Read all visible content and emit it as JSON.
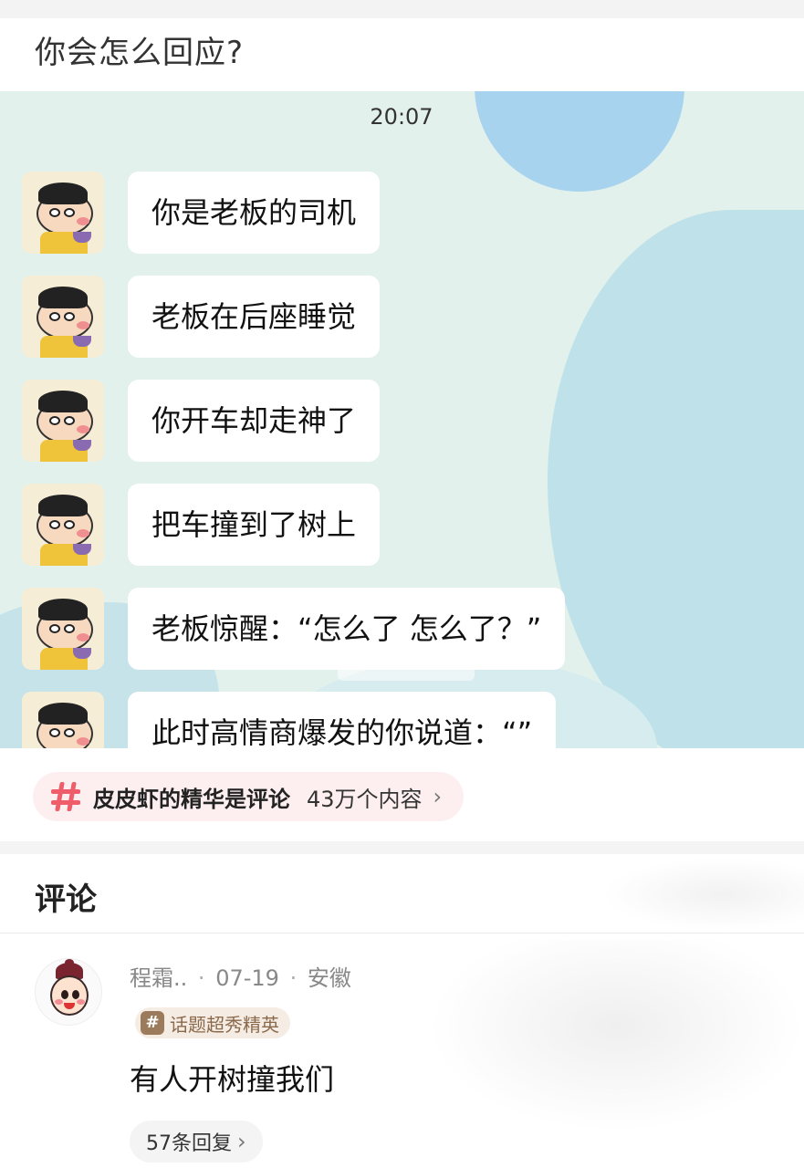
{
  "post": {
    "title": "你会怎么回应?"
  },
  "chat": {
    "time": "20:07",
    "messages": [
      "你是老板的司机",
      "老板在后座睡觉",
      "你开车却走神了",
      "把车撞到了树上",
      "老板惊醒：“怎么了 怎么了？”",
      "此时高情商爆发的你说道：“”"
    ]
  },
  "topic": {
    "name": "皮皮虾的精华是评论",
    "count": "43万个内容",
    "icon": "hash-icon"
  },
  "comments_section": {
    "title": "评论"
  },
  "comment": {
    "user": "程霜..",
    "date": "07-19",
    "location": "安徽",
    "badge": "话题超秀精英",
    "badge_icon": "#",
    "text": "有人开树撞我们",
    "replies": "57条回复"
  },
  "colors": {
    "accent": "#ef5d6b",
    "chip_bg": "#fdeff0",
    "chat_bg": "#e3f1ec"
  }
}
